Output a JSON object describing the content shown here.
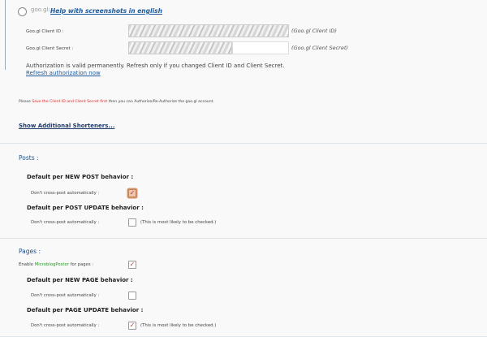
{
  "googl": {
    "logo_text": "goo.gl",
    "separator": ":",
    "help_link": "Help with screenshots in english",
    "client_id_label": "Goo.gl Client ID :",
    "client_id_hint": "(Goo.gl Client ID)",
    "client_secret_label": "Goo.gl Client Secret :",
    "client_secret_hint": "(Goo.gl Client Secret)",
    "auth_status": "Authorization is valid permanently. Refresh only if you changed Client ID and Client Secret.",
    "refresh_link": "Refresh authorization now",
    "notice_prefix": "Please",
    "notice_red": "Save the Client ID and Client Secret first",
    "notice_suffix": "then you can Authorize/Re-Authorize the goo.gl account."
  },
  "show_additional_shorteners": "Show Additional Shorteners...",
  "posts": {
    "title": "Posts :",
    "new_heading": "Default per NEW POST behavior :",
    "new_option": "Don't cross-post automatically :",
    "new_checked": true,
    "update_heading": "Default per POST UPDATE behavior :",
    "update_option": "Don't cross-post automatically :",
    "update_checked": false,
    "update_note": "(This is most likely to be checked.)"
  },
  "pages": {
    "title": "Pages :",
    "enable_prefix": "Enable",
    "enable_brand": "MicroblogPoster",
    "enable_suffix": "for pages :",
    "enable_checked": true,
    "new_heading": "Default per NEW PAGE behavior :",
    "new_option": "Don't cross-post automatically :",
    "new_checked": false,
    "update_heading": "Default per PAGE UPDATE behavior :",
    "update_option": "Don't cross-post automatically :",
    "update_checked": true,
    "update_note": "(This is most likely to be checked.)"
  },
  "colors": {
    "link": "#1e5a9c",
    "section": "#1e4f86",
    "warning": "#dd2222",
    "brand_green": "#1c9c1c",
    "check": "#c0392b"
  }
}
